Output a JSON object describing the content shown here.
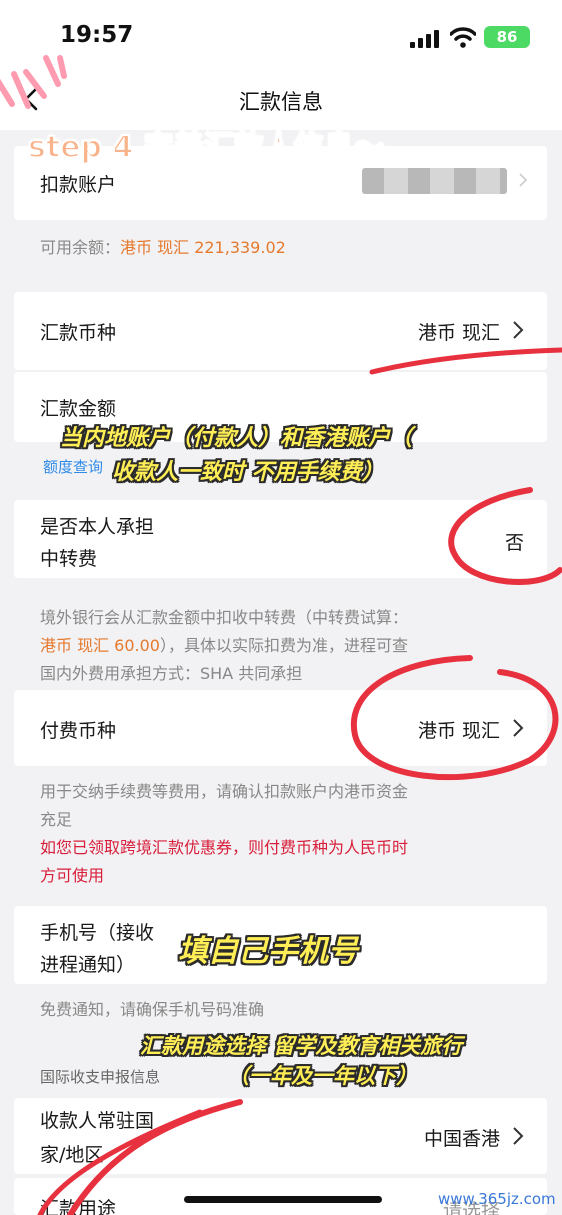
{
  "status_bar": {
    "time": "19:57",
    "battery": "86"
  },
  "nav": {
    "title": "汇款信息"
  },
  "debit_account": {
    "label": "扣款账户"
  },
  "balance": {
    "prefix": "可用余额：",
    "amount": "港币 现汇 221,339.02"
  },
  "currency": {
    "label": "汇款币种",
    "value": "港币 现汇"
  },
  "amount": {
    "label": "汇款金额",
    "quota_link": "额度查询"
  },
  "bear_fee": {
    "label_line1": "是否本人承担",
    "label_line2": "中转费",
    "value": "否"
  },
  "fee_note": {
    "line1": "境外银行会从汇款金额中扣收中转费（中转费试算：",
    "line2_amount": "港币 现汇 60.00",
    "line2_rest": "），具体以实际扣费为准，进程可查",
    "line3": "国内外费用承担方式：SHA 共同承担"
  },
  "pay_currency": {
    "label": "付费币种",
    "value": "港币 现汇"
  },
  "pay_note": {
    "line1": "用于交纳手续费等费用，请确认扣款账户内港币资金",
    "line2": "充足",
    "red_line1": "如您已领取跨境汇款优惠券，则付费币种为人民币时",
    "red_line2": "方可使用"
  },
  "phone": {
    "label_line1": "手机号（接收",
    "label_line2": "进程通知）"
  },
  "phone_note": "免费通知，请确保手机号码准确",
  "intl_section": {
    "title": "国际收支申报信息"
  },
  "residence": {
    "label_line1": "收款人常驻国",
    "label_line2": "家/地区",
    "value": "中国香港"
  },
  "purpose": {
    "label": "汇款用途",
    "value": "请选择"
  },
  "annotations": {
    "step": "step 4 完善汇款人信息～",
    "fee_tip_line1": "当内地账户（付款人）和香港账户（",
    "fee_tip_line2": "收款人一致时 不用手续费）",
    "phone_tip": "填自己手机号",
    "purpose_tip_line1": "汇款用途选择 留学及教育相关旅行",
    "purpose_tip_line2": "（一年及一年以下）"
  },
  "watermark": "www.365jz.com",
  "colors": {
    "orange": "#e5792d",
    "red": "#d81e3a",
    "blue": "#2f8be8",
    "circle": "#e8313f"
  }
}
